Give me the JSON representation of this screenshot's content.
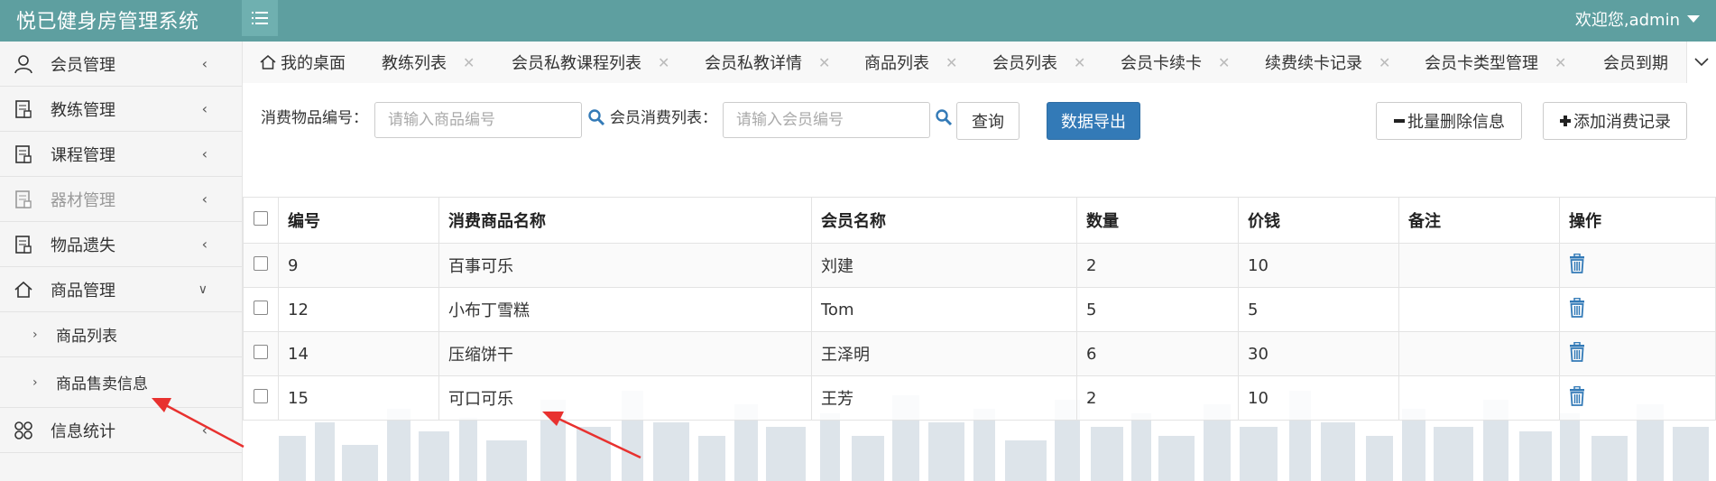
{
  "header": {
    "title": "悦已健身房管理系统",
    "welcome": "欢迎您,admin"
  },
  "sidebar": {
    "items": [
      {
        "label": "会员管理",
        "icon": "user-icon"
      },
      {
        "label": "教练管理",
        "icon": "document-icon"
      },
      {
        "label": "课程管理",
        "icon": "document-icon"
      },
      {
        "label": "器材管理",
        "icon": "document-icon"
      },
      {
        "label": "物品遗失",
        "icon": "document-icon"
      },
      {
        "label": "商品管理",
        "icon": "home-icon"
      },
      {
        "label": "信息统计",
        "icon": "grid-icon"
      }
    ],
    "subitems": [
      "商品列表",
      "商品售卖信息"
    ]
  },
  "tabs": [
    "我的桌面",
    "教练列表",
    "会员私教课程列表",
    "会员私教详情",
    "商品列表",
    "会员列表",
    "会员卡续卡",
    "续费续卡记录",
    "会员卡类型管理",
    "会员到期"
  ],
  "filter": {
    "product_label": "消费物品编号：",
    "product_placeholder": "请输入商品编号",
    "member_label": "会员消费列表：",
    "member_placeholder": "请输入会员编号",
    "query_button": "查询",
    "export_button": "数据导出",
    "batch_delete_button": "批量删除信息",
    "add_button": "添加消费记录"
  },
  "table": {
    "headers": [
      "编号",
      "消费商品名称",
      "会员名称",
      "数量",
      "价钱",
      "备注",
      "操作"
    ],
    "rows": [
      {
        "id": "9",
        "product": "百事可乐",
        "member": "刘建",
        "qty": "2",
        "price": "10",
        "note": ""
      },
      {
        "id": "12",
        "product": "小布丁雪糕",
        "member": "Tom",
        "qty": "5",
        "price": "5",
        "note": ""
      },
      {
        "id": "14",
        "product": "压缩饼干",
        "member": "王泽明",
        "qty": "6",
        "price": "30",
        "note": ""
      },
      {
        "id": "15",
        "product": "可口可乐",
        "member": "王芳",
        "qty": "2",
        "price": "10",
        "note": ""
      }
    ]
  },
  "colors": {
    "header_bg": "#5e9fa0",
    "primary": "#337ab7",
    "trash": "#337ab7",
    "annotation_arrow": "#e8312f"
  }
}
